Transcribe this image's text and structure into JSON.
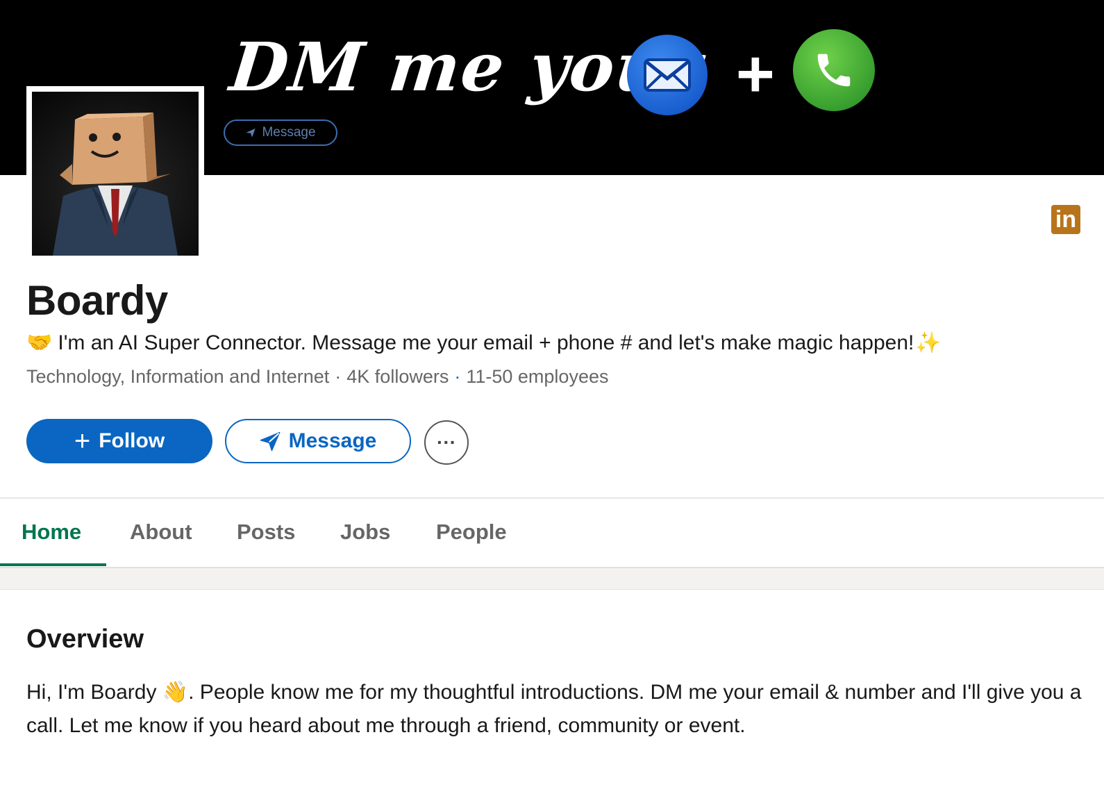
{
  "banner": {
    "headline": "DM me your",
    "plus": "+",
    "message_chip": "Message",
    "mail_icon": "envelope-icon",
    "phone_icon": "phone-icon"
  },
  "profile": {
    "name": "Boardy",
    "tagline_emoji": "🤝",
    "tagline": "I'm an AI Super Connector. Message me your email + phone # and let's make magic happen!",
    "tagline_end_emoji": "✨",
    "industry": "Technology, Information and Internet",
    "followers": "4K followers",
    "employees": "11-50 employees",
    "linkedin_badge": "in"
  },
  "actions": {
    "follow": "Follow",
    "follow_prefix": "+",
    "message": "Message",
    "more": "···"
  },
  "tabs": [
    {
      "label": "Home",
      "active": true
    },
    {
      "label": "About"
    },
    {
      "label": "Posts"
    },
    {
      "label": "Jobs"
    },
    {
      "label": "People"
    }
  ],
  "overview": {
    "title": "Overview",
    "text_before_emoji": "Hi, I'm Boardy ",
    "emoji": "👋",
    "text_after_emoji": ". People know me for my thoughtful introductions. DM me your email & number and I'll give you a call. Let me know if you heard about me through a friend, community or event."
  },
  "colors": {
    "brand_blue": "#0a66c2",
    "tab_active": "#01754f",
    "banner_bg": "#000000",
    "linkedin_badge": "#b8741a"
  }
}
